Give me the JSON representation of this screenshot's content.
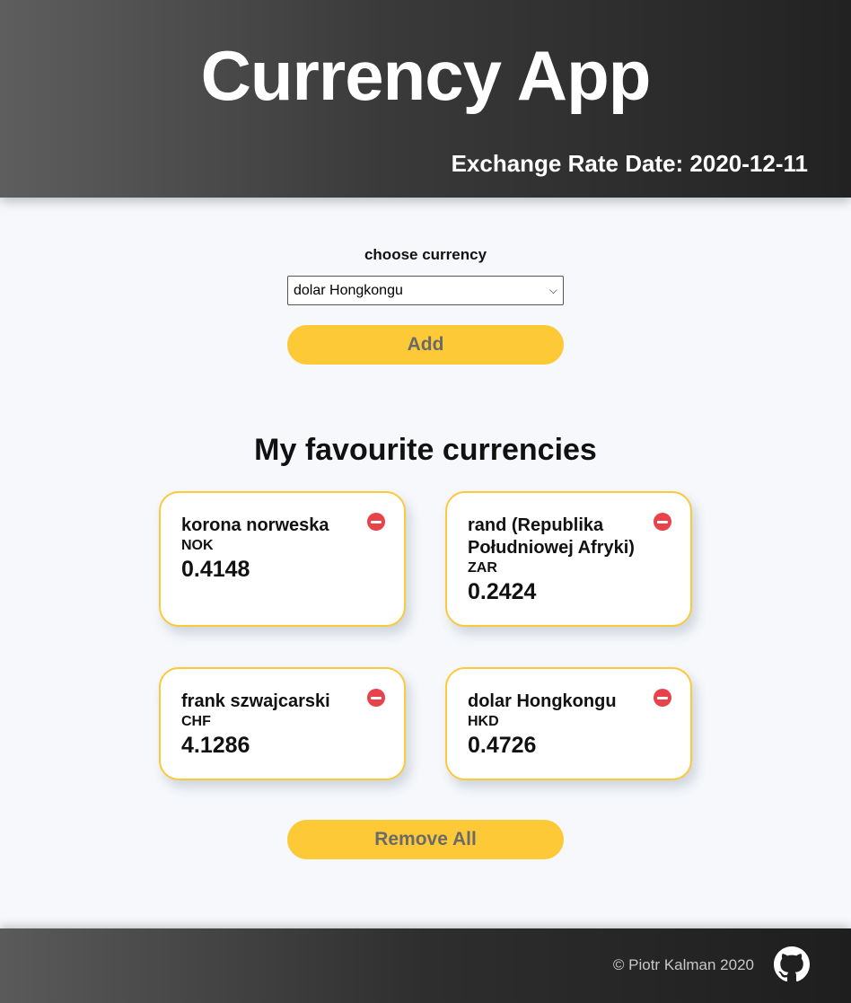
{
  "header": {
    "title": "Currency App",
    "rate_date": "Exchange Rate Date: 2020-12-11"
  },
  "picker": {
    "label": "choose currency",
    "selected": "dolar Hongkongu",
    "add_label": "Add"
  },
  "favourites": {
    "title": "My favourite currencies",
    "cards": [
      {
        "name": "korona norweska",
        "code": "NOK",
        "rate": "0.4148"
      },
      {
        "name": "rand (Republika Południowej Afryki)",
        "code": "ZAR",
        "rate": "0.2424"
      },
      {
        "name": "frank szwajcarski",
        "code": "CHF",
        "rate": "4.1286"
      },
      {
        "name": "dolar Hongkongu",
        "code": "HKD",
        "rate": "0.4726"
      }
    ],
    "remove_all_label": "Remove All"
  },
  "footer": {
    "copyright": "© Piotr Kalman 2020",
    "icon": "github-icon"
  },
  "colors": {
    "accent": "#fec937",
    "remove": "#e8434b",
    "card_border": "#fcc93b"
  }
}
